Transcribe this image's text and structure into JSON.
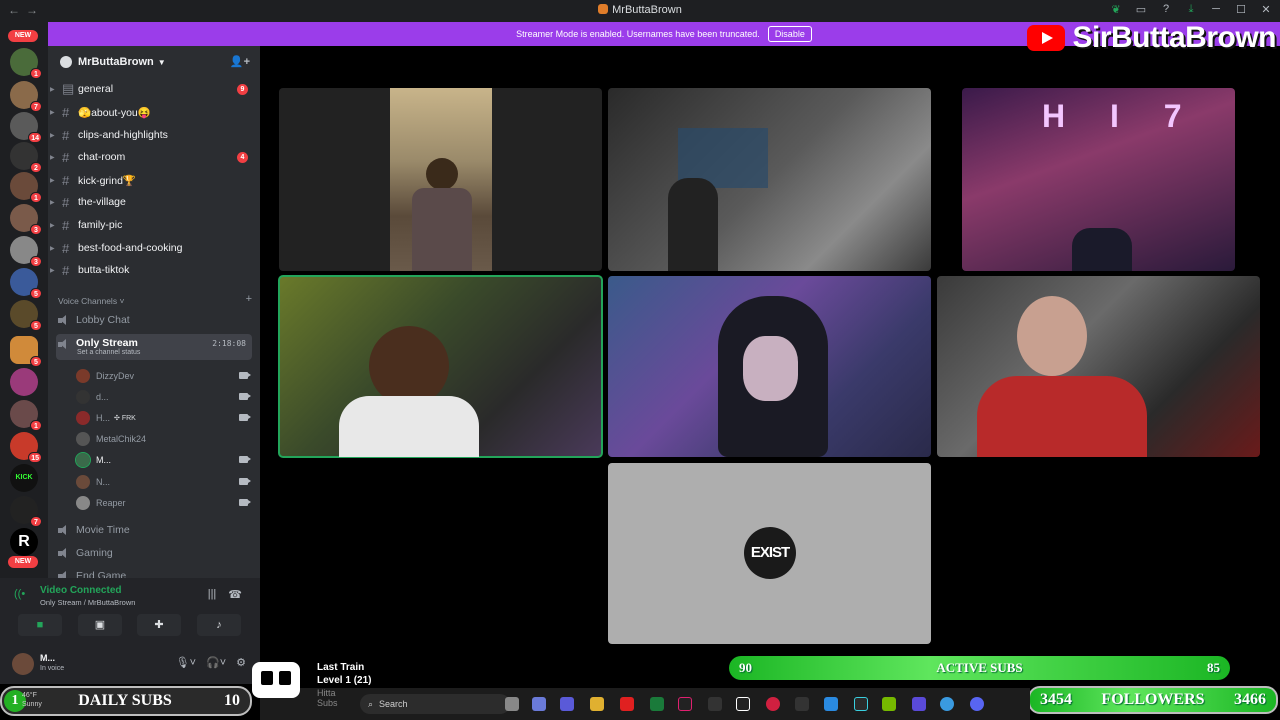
{
  "window": {
    "title": "MrButtaBrown",
    "controls": [
      "─",
      "☐",
      "✕"
    ]
  },
  "streamer_banner": {
    "text": "Streamer Mode is enabled. Usernames have been truncated.",
    "button": "Disable"
  },
  "brand": {
    "name": "SirButtaBrown"
  },
  "server_rail": {
    "new_label_top": "NEW",
    "new_label_bottom": "NEW",
    "badges": [
      "1",
      "7",
      "14",
      "2",
      "1",
      "3",
      "3",
      "5",
      "5",
      "5",
      "1",
      "15",
      "7"
    ]
  },
  "server": {
    "name": "MrButtaBrown"
  },
  "text_channels": [
    {
      "name": "general",
      "badge": "9"
    },
    {
      "name": "🫣about-you😝",
      "badge": ""
    },
    {
      "name": "clips-and-highlights",
      "badge": ""
    },
    {
      "name": "chat-room",
      "badge": "4"
    },
    {
      "name": "kick-grind🏆",
      "badge": ""
    },
    {
      "name": "the-village",
      "badge": ""
    },
    {
      "name": "family-pic",
      "badge": ""
    },
    {
      "name": "best-food-and-cooking",
      "badge": ""
    },
    {
      "name": "butta-tiktok",
      "badge": ""
    }
  ],
  "voice_header": "Voice Channels",
  "voice_channels": {
    "lobby": "Lobby Chat",
    "active": "Only Stream",
    "active_timer": "2:18:08",
    "active_status": "Set a channel status",
    "movie": "Movie Time",
    "gaming": "Gaming",
    "endgame": "End Game"
  },
  "voice_users": [
    {
      "name": "DizzyDev",
      "tag": ""
    },
    {
      "name": "d...",
      "tag": ""
    },
    {
      "name": "H...",
      "tag": "FRK"
    },
    {
      "name": "MetalChik24",
      "tag": ""
    },
    {
      "name": "M...",
      "tag": ""
    },
    {
      "name": "N...",
      "tag": ""
    },
    {
      "name": "Reaper",
      "tag": ""
    }
  ],
  "voice_panel": {
    "status": "Video Connected",
    "location": "Only Stream / MrButtaBrown"
  },
  "user_panel": {
    "name": "M...",
    "status": "In voice"
  },
  "stage": {
    "exist_text": "EXIST"
  },
  "overlays": {
    "active_subs": {
      "left": "90",
      "label": "ACTIVE SUBS",
      "right": "85"
    },
    "daily_subs": {
      "left": "1",
      "label": "DAILY SUBS",
      "right": "10"
    },
    "followers": {
      "left": "3454",
      "label": "FOLLOWERS",
      "right": "3466"
    }
  },
  "music": {
    "track": "Last Train",
    "level": "Level 1  (21)",
    "line3": "Hitta",
    "line4": "Subs"
  },
  "weather": {
    "temp": "46°F",
    "cond": "Sunny"
  },
  "taskbar": {
    "search_placeholder": "Search"
  }
}
